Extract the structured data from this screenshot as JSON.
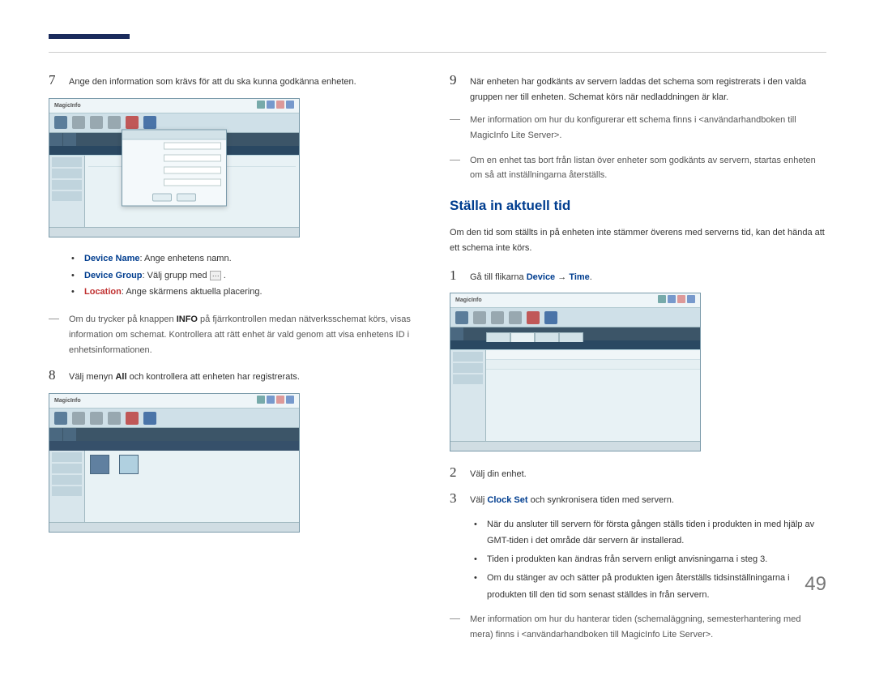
{
  "page_number": "49",
  "left": {
    "step7": {
      "num": "7",
      "text": "Ange den information som krävs för att du ska kunna godkänna enheten."
    },
    "ss1_logo": "MagicInfo",
    "bullets": {
      "device_name_label": "Device Name",
      "device_name_text": ": Ange enhetens namn.",
      "device_group_label": "Device Group",
      "device_group_text_before": ": Välj grupp med ",
      "device_group_text_after": " .",
      "location_label": "Location",
      "location_text": ": Ange skärmens aktuella placering."
    },
    "note": {
      "before_info": "Om du trycker på knappen ",
      "info_word": "INFO",
      "after_info": " på fjärrkontrollen medan nätverksschemat körs, visas information om schemat. Kontrollera att rätt enhet är vald genom att visa enhetens ID i enhetsinformationen."
    },
    "step8": {
      "num": "8",
      "text_before": "Välj menyn ",
      "all_word": "All",
      "text_after": " och kontrollera att enheten har registrerats."
    }
  },
  "right": {
    "step9": {
      "num": "9",
      "text": "När enheten har godkänts av servern laddas det schema som registrerats i den valda gruppen ner till enheten. Schemat körs när nedladdningen är klar."
    },
    "note1": "Mer information om hur du konfigurerar ett schema finns i <användarhandboken till MagicInfo Lite Server>.",
    "note2": "Om en enhet tas bort från listan över enheter som godkänts av servern, startas enheten om så att inställningarna återställs.",
    "section_title": "Ställa in aktuell tid",
    "section_intro": "Om den tid som ställts in på enheten inte stämmer överens med serverns tid, kan det hända att ett schema inte körs.",
    "step1": {
      "num": "1",
      "text_before": "Gå till flikarna ",
      "device_word": "Device",
      "arrow": " → ",
      "time_word": "Time",
      "period": "."
    },
    "step2": {
      "num": "2",
      "text": "Välj din enhet."
    },
    "step3": {
      "num": "3",
      "text_before": "Välj ",
      "clock_set": "Clock Set",
      "text_after": " och synkronisera tiden med servern."
    },
    "sub_bullets": {
      "b1": "När du ansluter till servern för första gången ställs tiden i produkten in med hjälp av GMT-tiden i det område där servern är installerad.",
      "b2": "Tiden i produkten kan ändras från servern enligt anvisningarna i steg 3.",
      "b3": "Om du stänger av och sätter på produkten igen återställs tidsinställningarna i produkten till den tid som senast ställdes in från servern."
    },
    "note3": "Mer information om hur du hanterar tiden (schemaläggning, semesterhantering med mera) finns i <användarhandboken till MagicInfo Lite Server>."
  }
}
